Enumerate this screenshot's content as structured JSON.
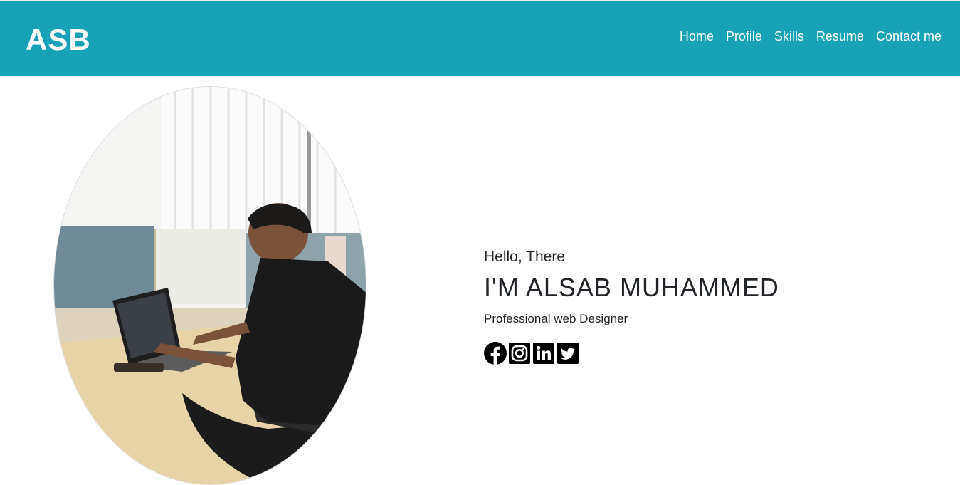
{
  "brand": "ASB",
  "nav": {
    "items": [
      {
        "label": "Home"
      },
      {
        "label": "Profile"
      },
      {
        "label": "Skills"
      },
      {
        "label": "Resume"
      },
      {
        "label": "Contact me"
      }
    ]
  },
  "hero": {
    "greeting": "Hello, There",
    "name": "I'M ALSAB MUHAMMED",
    "role": "Professional web Designer",
    "photo_icon": "profile-photo",
    "social": [
      {
        "icon": "facebook-icon"
      },
      {
        "icon": "instagram-icon"
      },
      {
        "icon": "linkedin-icon"
      },
      {
        "icon": "twitter-icon"
      }
    ]
  },
  "colors": {
    "navbar": "#17a2b8",
    "nav_text": "#ffffff",
    "body_text": "#212529",
    "icons": "#000000"
  }
}
